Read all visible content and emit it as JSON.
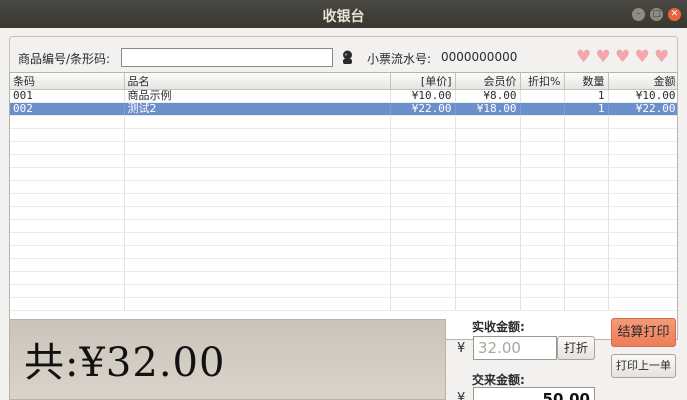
{
  "window": {
    "title": "收银台"
  },
  "search": {
    "label": "商品编号/条形码:",
    "value": "",
    "ticket_label": "小票流水号:",
    "ticket_no": "0000000000"
  },
  "hearts": [
    "♥",
    "♥",
    "♥",
    "♥",
    "♥"
  ],
  "table": {
    "columns": [
      "条码",
      "品名",
      "[单价]",
      "会员价",
      "折扣%",
      "数量",
      "金额"
    ],
    "rows": [
      [
        "001",
        "商品示例",
        "¥10.00",
        "¥8.00",
        "",
        "1",
        "¥10.00"
      ],
      [
        "002",
        "测试2",
        "¥22.00",
        "¥18.00",
        "",
        "1",
        "¥22.00"
      ]
    ],
    "selected_row": 1
  },
  "total": {
    "text": "共:¥32.00"
  },
  "payment": {
    "received_label": "实收金额:",
    "currency": "¥",
    "received_value": "32.00",
    "discount_button": "打折",
    "tender_label": "交来金额:",
    "tender_value": "50.00",
    "checkout_button": "结算打印",
    "reprint_button": "打印上一单"
  },
  "colors": {
    "selection": "#6b8fca",
    "checkout": "#ec7f58",
    "heart": "#f4a6ad"
  }
}
